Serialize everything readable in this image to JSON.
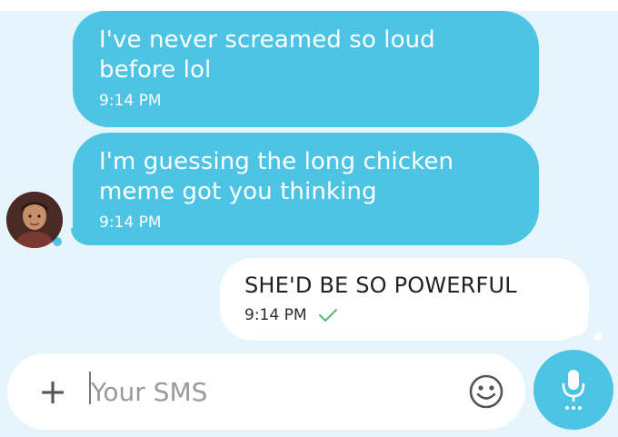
{
  "conversation": {
    "messages": [
      {
        "direction": "incoming",
        "lines": [
          "I've never screamed so loud",
          "before lol"
        ],
        "time": "9:14 PM"
      },
      {
        "direction": "incoming",
        "lines": [
          "I'm guessing the long chicken",
          "meme got you thinking"
        ],
        "time": "9:14 PM"
      },
      {
        "direction": "outgoing",
        "lines": [
          "SHE'D BE SO POWERFUL"
        ],
        "time": "9:14 PM",
        "status_icon": "check-icon"
      }
    ]
  },
  "composer": {
    "placeholder": "Your SMS",
    "value": "",
    "icons": {
      "attach": "plus-icon",
      "emoji": "smiley-icon",
      "voice": "microphone-icon"
    },
    "plus_glyph": "+"
  },
  "colors": {
    "background": "#e6f5fb",
    "incoming_bubble": "#4ec4e5",
    "outgoing_bubble": "#ffffff",
    "check": "#5ab870",
    "mic_button": "#4ec4e5"
  }
}
